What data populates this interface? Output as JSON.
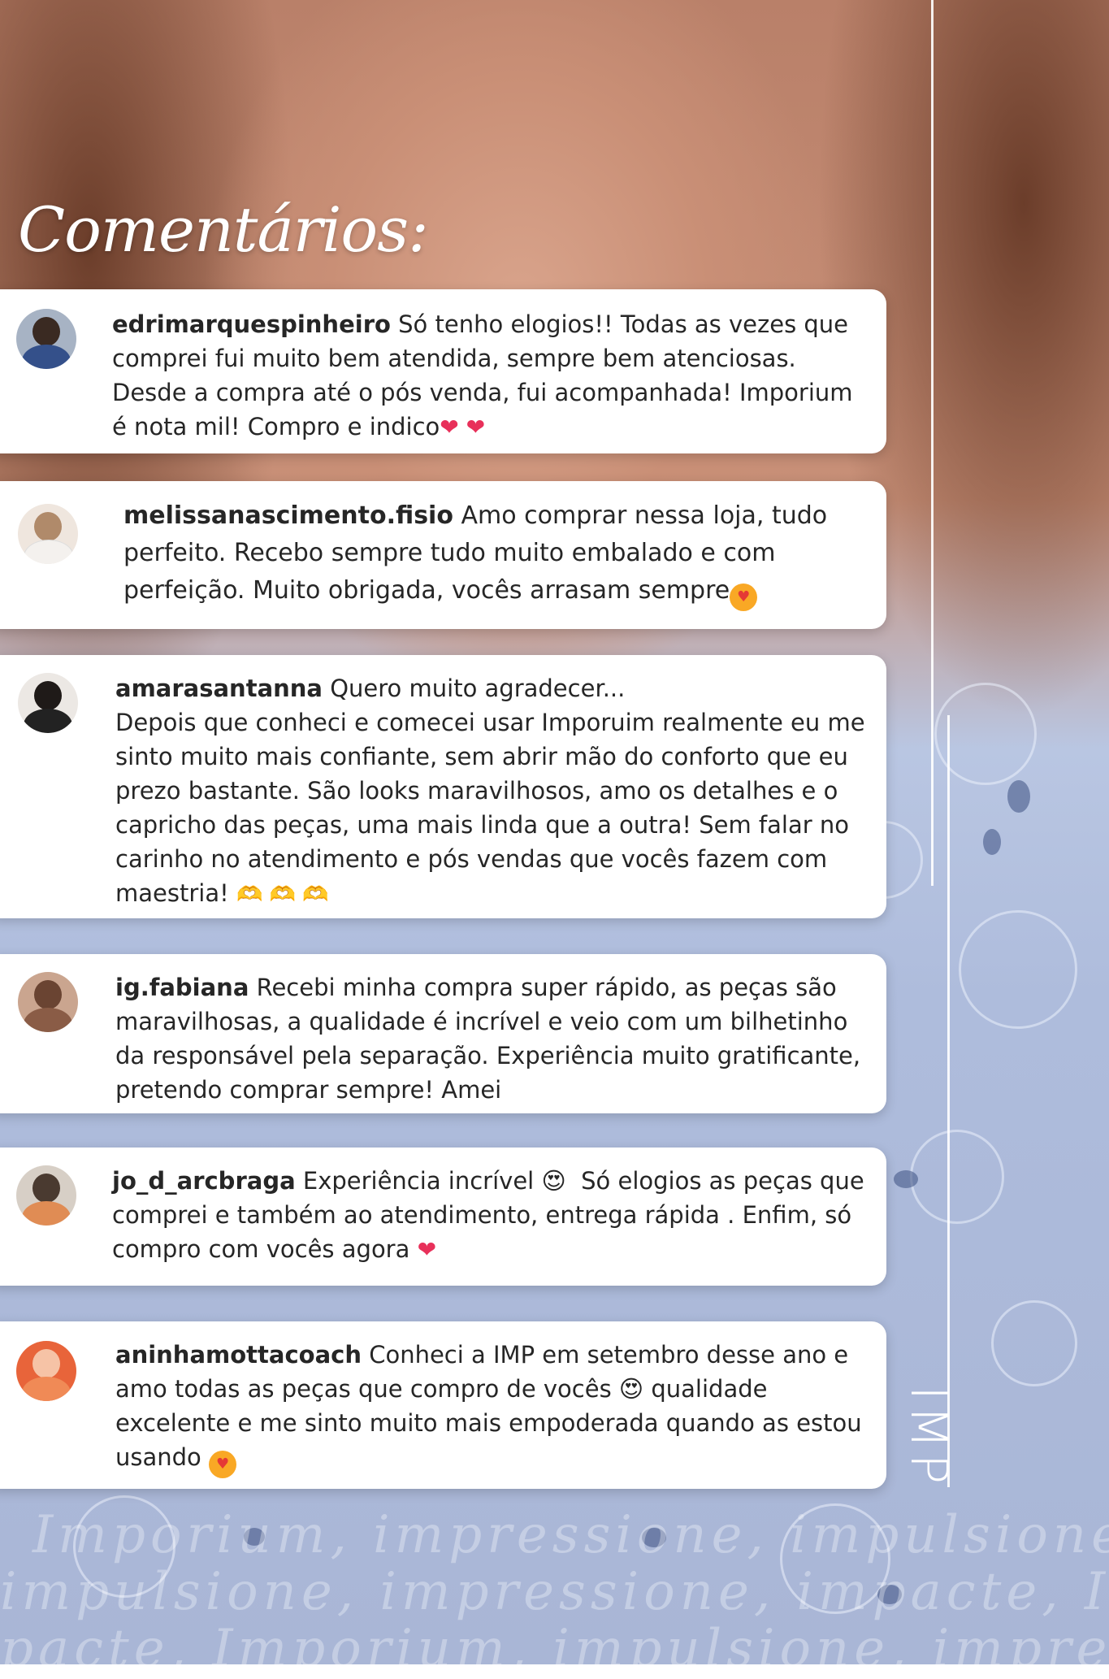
{
  "heading": "Comentários:",
  "brand": "IMP",
  "slogan_lines": [
    "Imporium, impressione, impulsione, impacte",
    "impulsione, impressione, impacte, Imporium",
    "pacte, Imporium, impulsione, impressione, I"
  ],
  "comments": [
    {
      "username": "edrimarquespinheiro",
      "text": " Só tenho elogios!! Todas as vezes que\ncomprei fui muito bem atendida, sempre bem atenciosas.\nDesde a compra até o pós venda, fui acompanhada! Imporium\né nota mil! Compro e indico",
      "emoji": "❤ ❤"
    },
    {
      "username": "melissanascimento.fisio",
      "text": " Amo comprar nessa loja, tudo\nperfeito. Recebo sempre tudo muito embalado e com\nperfeição. Muito obrigada, vocês arrasam sempre",
      "emoji": "😍"
    },
    {
      "username": "amarasantanna",
      "text": " Quero muito agradecer...\nDepois que conheci e comecei usar Imporuim realmente eu me\nsinto muito mais confiante, sem abrir mão do conforto que eu\nprezo bastante. São looks maravilhosos, amo os detalhes e o\ncapricho das peças, uma mais linda que a outra! Sem falar no\ncarinho no atendimento e pós vendas que vocês fazem com\nmaestria!",
      "emoji": "🫶 🫶 🫶"
    },
    {
      "username": "ig.fabiana",
      "text": " Recebi minha compra super rápido, as peças são\nmaravilhosas, a qualidade é incrível e veio com um bilhetinho\nda responsável pela separação. Experiência muito gratificante,\npretendo comprar sempre! Amei",
      "emoji": ""
    },
    {
      "username": "jo_d_arcbraga",
      "text": " Experiência incrível 😍  Só elogios as peças que\ncomprei e também ao atendimento, entrega rápida . Enfim, só\ncompro com vocês agora",
      "emoji": "❤"
    },
    {
      "username": "aninhamottacoach",
      "text": " Conheci a IMP em setembro desse ano e\namo todas as peças que compro de vocês 😍 qualidade\nexcelente e me sinto muito mais empoderada quando as estou\nusando",
      "emoji": "😍"
    }
  ],
  "colors": {
    "text": "#262626",
    "heart": "#e8305a",
    "card": "#ffffff"
  }
}
